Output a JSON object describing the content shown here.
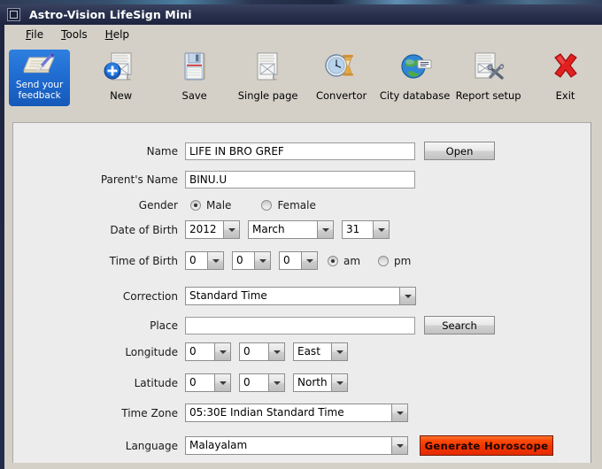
{
  "window": {
    "title": "Astro-Vision LifeSign Mini",
    "icon": "app-window-icon"
  },
  "menubar": {
    "items": [
      {
        "label": "File",
        "mnemonic": "F",
        "rest": "ile"
      },
      {
        "label": "Tools",
        "mnemonic": "T",
        "rest": "ools"
      },
      {
        "label": "Help",
        "mnemonic": "H",
        "rest": "elp"
      }
    ]
  },
  "toolbar": {
    "feedback": {
      "line1": "Send your",
      "line2": "feedback",
      "icon": "notepad-pen-icon"
    },
    "buttons": [
      {
        "label": "New",
        "icon": "new-document-plus-icon"
      },
      {
        "label": "Save",
        "icon": "floppy-disk-icon"
      },
      {
        "label": "Single page",
        "icon": "single-page-icon"
      },
      {
        "label": "Convertor",
        "icon": "clock-hourglass-icon"
      },
      {
        "label": "City database",
        "icon": "globe-database-icon"
      },
      {
        "label": "Report setup",
        "icon": "page-tools-icon"
      },
      {
        "label": "Exit",
        "icon": "red-x-icon"
      }
    ]
  },
  "form": {
    "name": {
      "label": "Name",
      "value": "LIFE IN BRO GREF",
      "placeholder": "",
      "button": "Open"
    },
    "parent_name": {
      "label": "Parent's Name",
      "value": "BINU.U",
      "placeholder": ""
    },
    "gender": {
      "label": "Gender",
      "options": [
        {
          "label": "Male",
          "selected": true
        },
        {
          "label": "Female",
          "selected": false
        }
      ]
    },
    "date_of_birth": {
      "label": "Date of Birth",
      "year": "2012",
      "month": "March",
      "day": "31"
    },
    "time_of_birth": {
      "label": "Time of Birth",
      "hour": "0",
      "minute": "0",
      "second": "0",
      "meridiem": [
        {
          "label": "am",
          "selected": true
        },
        {
          "label": "pm",
          "selected": false
        }
      ]
    },
    "correction": {
      "label": "Correction",
      "value": "Standard Time"
    },
    "place": {
      "label": "Place",
      "value": "",
      "placeholder": "",
      "button": "Search"
    },
    "longitude": {
      "label": "Longitude",
      "degrees": "0",
      "minutes": "0",
      "direction": "East"
    },
    "latitude": {
      "label": "Latitude",
      "degrees": "0",
      "minutes": "0",
      "direction": "North"
    },
    "time_zone": {
      "label": "Time Zone",
      "value": "05:30E  Indian Standard Time"
    },
    "language": {
      "label": "Language",
      "value": "Malayalam",
      "action_button": "Generate  Horoscope"
    }
  },
  "colors": {
    "titlebar": "#2b3350",
    "toolbar_bg": "#d4d0c8",
    "panel_bg": "#ececec",
    "accent_red": "#f03500",
    "feedback_blue": "#1f6bd0"
  }
}
